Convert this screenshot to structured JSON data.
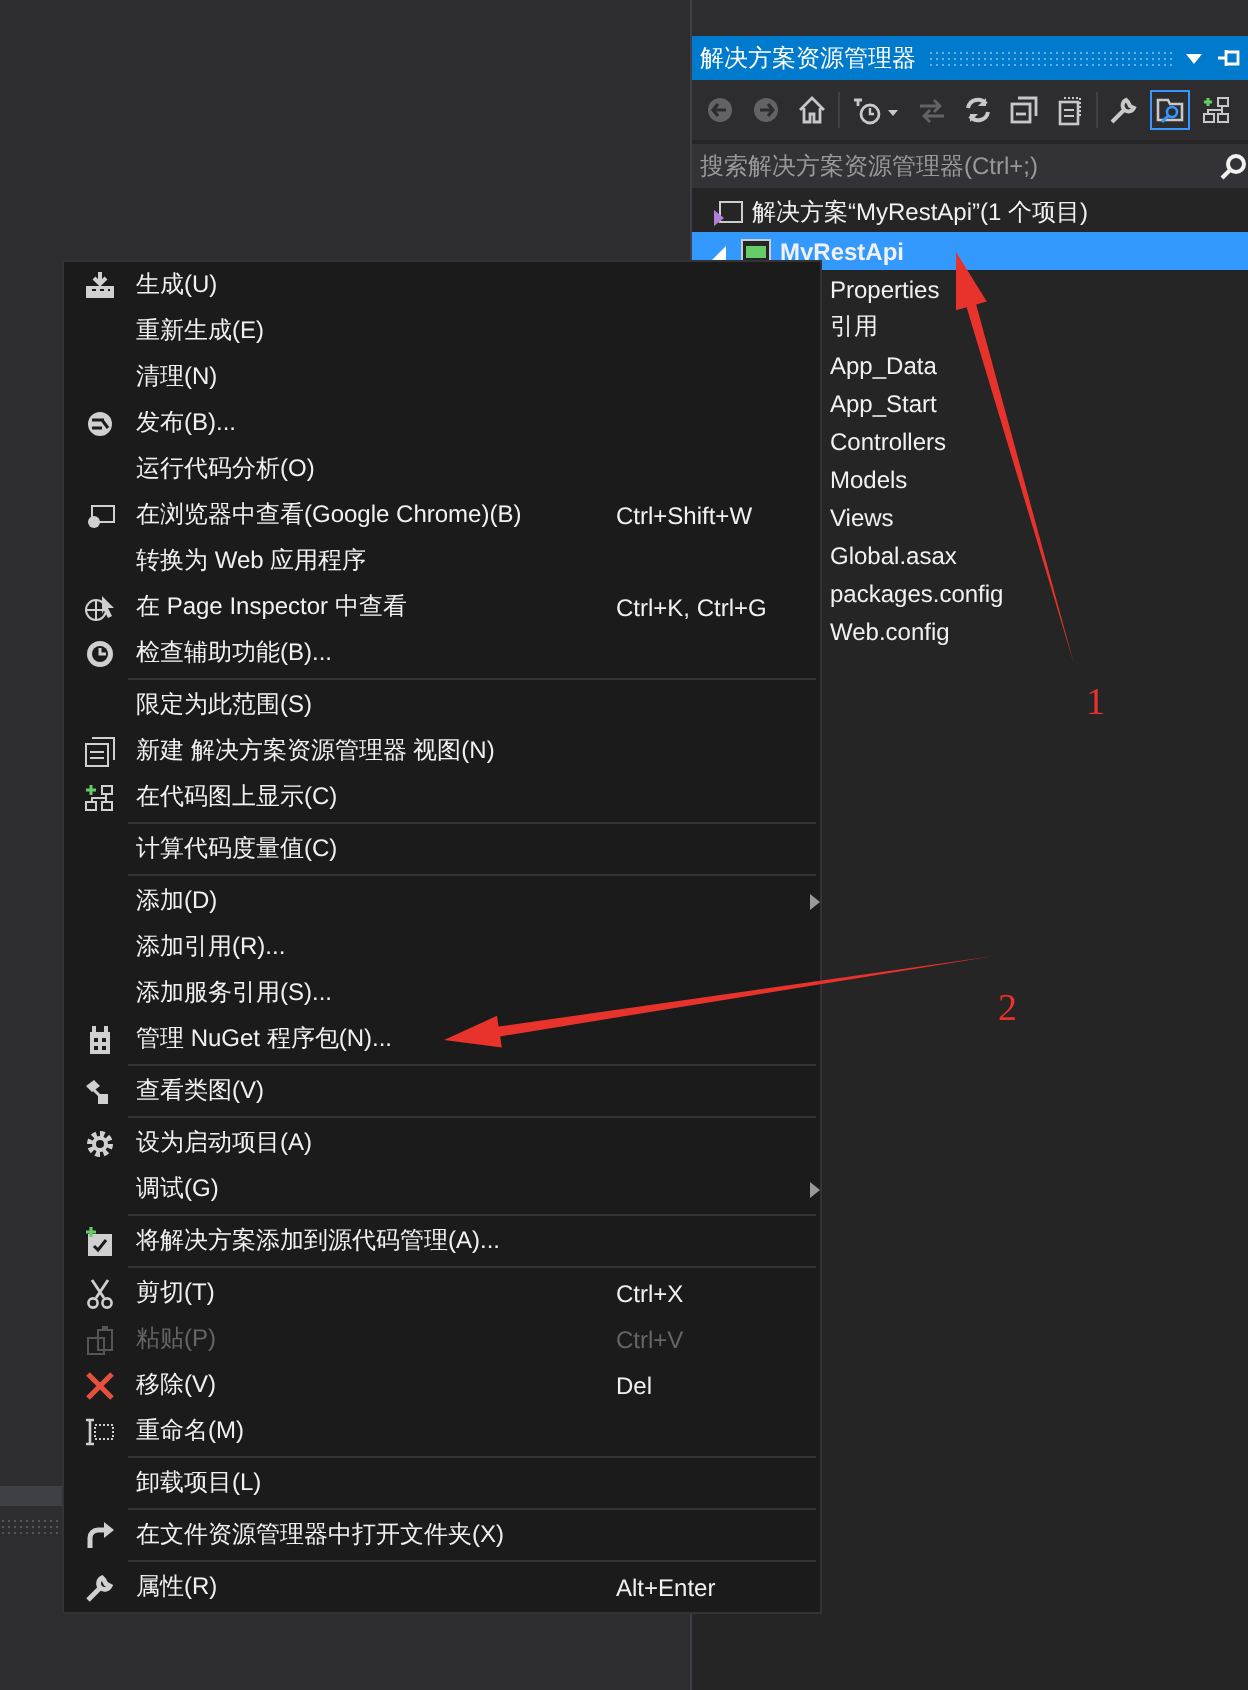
{
  "solution_explorer": {
    "title": "解决方案资源管理器",
    "toolbar": [
      {
        "disabled": true,
        "selected": false
      },
      {
        "disabled": true,
        "selected": false
      },
      {
        "disabled": false,
        "selected": false
      },
      {
        "disabled": false,
        "selected": false
      },
      {
        "disabled": true,
        "selected": false
      },
      {
        "disabled": false,
        "selected": false
      },
      {
        "disabled": false,
        "selected": false
      },
      {
        "disabled": false,
        "selected": false
      },
      {
        "disabled": false,
        "selected": false
      },
      {
        "disabled": false,
        "selected": true
      },
      {
        "disabled": false,
        "selected": false
      }
    ],
    "search": {
      "placeholder": "搜索解决方案资源管理器(Ctrl+;)"
    },
    "tree": [
      {
        "label": "解决方案“MyRestApi”(1 个项目)",
        "selected": false,
        "children": [
          {
            "label": "MyRestApi",
            "selected": true,
            "expanded": true,
            "children": [
              {
                "label": "Properties",
                "selected": false
              },
              {
                "label": "引用",
                "selected": false
              },
              {
                "label": "App_Data",
                "selected": false
              },
              {
                "label": "App_Start",
                "selected": false
              },
              {
                "label": "Controllers",
                "selected": false
              },
              {
                "label": "Models",
                "selected": false
              },
              {
                "label": "Views",
                "selected": false
              },
              {
                "label": "Global.asax",
                "selected": false
              },
              {
                "label": "packages.config",
                "selected": false
              },
              {
                "label": "Web.config",
                "selected": false
              }
            ]
          }
        ]
      }
    ]
  },
  "context_menu": {
    "groups": [
      [
        {
          "label": "生成(U)",
          "disabled": false,
          "submenu": false
        },
        {
          "label": "重新生成(E)",
          "disabled": false,
          "submenu": false
        },
        {
          "label": "清理(N)",
          "disabled": false,
          "submenu": false
        },
        {
          "label": "发布(B)...",
          "disabled": false,
          "submenu": false
        },
        {
          "label": "运行代码分析(O)",
          "disabled": false,
          "submenu": false
        },
        {
          "label": "在浏览器中查看(Google Chrome)(B)",
          "shortcut": "Ctrl+Shift+W",
          "disabled": false,
          "submenu": false
        },
        {
          "label": "转换为 Web 应用程序",
          "disabled": false,
          "submenu": false
        },
        {
          "label": "在 Page Inspector 中查看",
          "shortcut": "Ctrl+K, Ctrl+G",
          "disabled": false,
          "submenu": false
        },
        {
          "label": "检查辅助功能(B)...",
          "disabled": false,
          "submenu": false
        }
      ],
      [
        {
          "label": "限定为此范围(S)",
          "disabled": false,
          "submenu": false
        },
        {
          "label": "新建 解决方案资源管理器 视图(N)",
          "disabled": false,
          "submenu": false
        },
        {
          "label": "在代码图上显示(C)",
          "disabled": false,
          "submenu": false
        }
      ],
      [
        {
          "label": "计算代码度量值(C)",
          "disabled": false,
          "submenu": false
        }
      ],
      [
        {
          "label": "添加(D)",
          "disabled": false,
          "submenu": true
        },
        {
          "label": "添加引用(R)...",
          "disabled": false,
          "submenu": false
        },
        {
          "label": "添加服务引用(S)...",
          "disabled": false,
          "submenu": false
        },
        {
          "label": "管理 NuGet 程序包(N)...",
          "disabled": false,
          "submenu": false
        }
      ],
      [
        {
          "label": "查看类图(V)",
          "disabled": false,
          "submenu": false
        }
      ],
      [
        {
          "label": "设为启动项目(A)",
          "disabled": false,
          "submenu": false
        },
        {
          "label": "调试(G)",
          "disabled": false,
          "submenu": true
        }
      ],
      [
        {
          "label": "将解决方案添加到源代码管理(A)...",
          "disabled": false,
          "submenu": false
        }
      ],
      [
        {
          "label": "剪切(T)",
          "shortcut": "Ctrl+X",
          "disabled": false,
          "submenu": false
        },
        {
          "label": "粘贴(P)",
          "shortcut": "Ctrl+V",
          "disabled": true,
          "submenu": false
        },
        {
          "label": "移除(V)",
          "shortcut": "Del",
          "disabled": false,
          "submenu": false
        },
        {
          "label": "重命名(M)",
          "disabled": false,
          "submenu": false
        }
      ],
      [
        {
          "label": "卸载项目(L)",
          "disabled": false,
          "submenu": false
        }
      ],
      [
        {
          "label": "在文件资源管理器中打开文件夹(X)",
          "disabled": false,
          "submenu": false
        }
      ],
      [
        {
          "label": "属性(R)",
          "shortcut": "Alt+Enter",
          "disabled": false,
          "submenu": false
        }
      ]
    ]
  },
  "annotations": [
    {
      "label": "1"
    },
    {
      "label": "2"
    }
  ]
}
